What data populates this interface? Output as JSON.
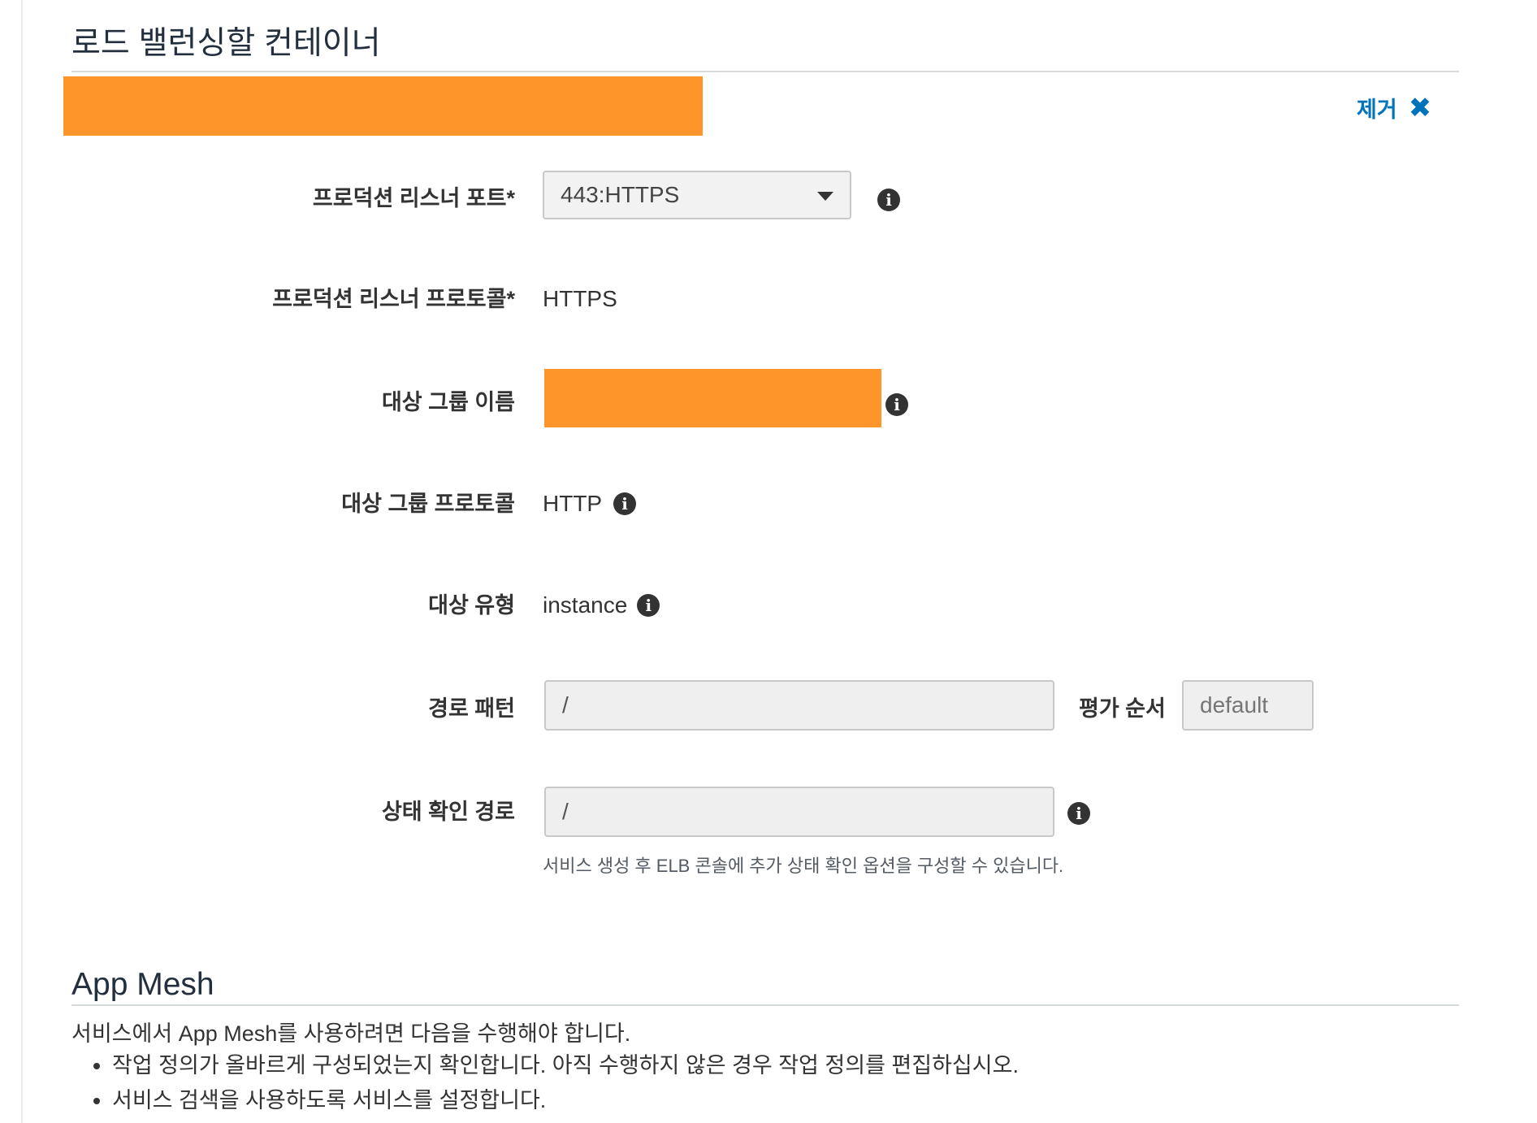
{
  "lb_section": {
    "title": "로드 밸런싱할 컨테이너",
    "remove_label": "제거",
    "remove_icon": "close-icon"
  },
  "form": {
    "listener_port": {
      "label": "프로덕션 리스너 포트*",
      "value": "443:HTTPS"
    },
    "listener_protocol": {
      "label": "프로덕션 리스너 프로토콜*",
      "value": "HTTPS"
    },
    "target_group_name": {
      "label": "대상 그룹 이름"
    },
    "target_group_protocol": {
      "label": "대상 그룹 프로토콜",
      "value": "HTTP"
    },
    "target_type": {
      "label": "대상 유형",
      "value": "instance"
    },
    "path_pattern": {
      "label": "경로 패턴",
      "value": "/"
    },
    "evaluation_order": {
      "label": "평가 순서",
      "placeholder": "default"
    },
    "health_check_path": {
      "label": "상태 확인 경로",
      "value": "/",
      "help": "서비스 생성 후 ELB 콘솔에 추가 상태 확인 옵션을 구성할 수 있습니다."
    }
  },
  "app_mesh": {
    "title": "App Mesh",
    "description": "서비스에서 App Mesh를 사용하려면 다음을 수행해야 합니다.",
    "items": [
      "작업 정의가 올바르게 구성되었는지 확인합니다. 아직 수행하지 않은 경우 작업 정의를 편집하십시오.",
      "서비스 검색을 사용하도록 서비스를 설정합니다."
    ]
  },
  "colors": {
    "redaction": "#fd952b",
    "link": "#0073bb",
    "title": "#232f3e"
  },
  "info_icon": "info-icon"
}
